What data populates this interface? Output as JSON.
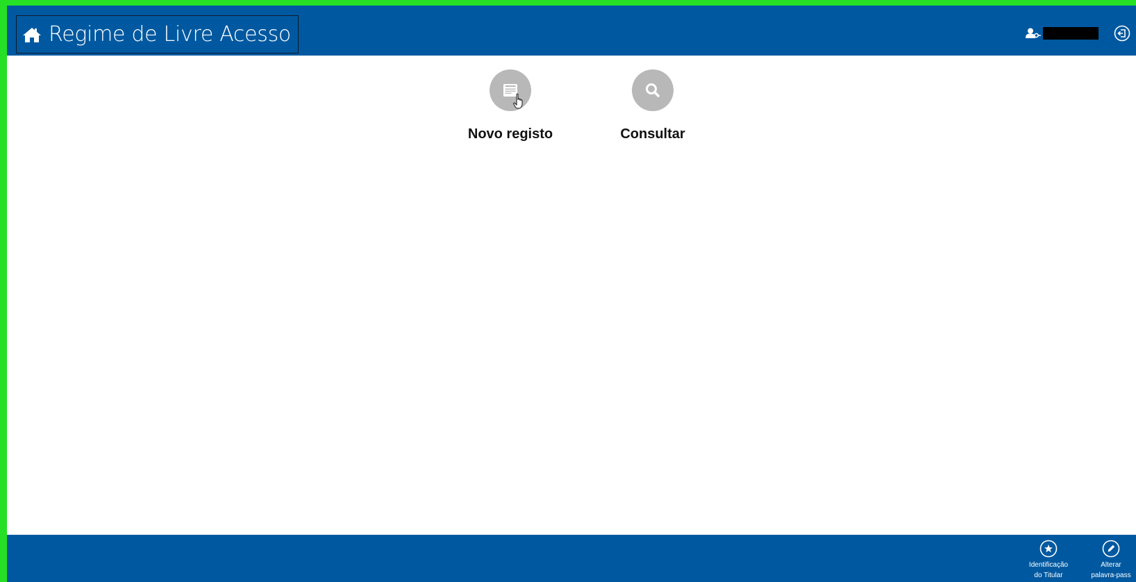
{
  "header": {
    "title": "Regime de Livre Acesso",
    "home_icon": "home-icon",
    "user_icon": "user-key-icon",
    "username": "",
    "logout_icon": "logout-icon"
  },
  "main": {
    "actions": [
      {
        "label": "Novo registo",
        "icon": "form-icon"
      },
      {
        "label": "Consultar",
        "icon": "search-icon"
      }
    ]
  },
  "footer": {
    "items": [
      {
        "line1": "Identificação",
        "line2": "do Titular",
        "icon": "star-icon"
      },
      {
        "line1": "Alterar",
        "line2": "palavra-pass",
        "icon": "pencil-icon"
      }
    ]
  },
  "colors": {
    "bar": "#0059a0",
    "frame": "#25e025",
    "action_circle": "#b8b8b8"
  }
}
